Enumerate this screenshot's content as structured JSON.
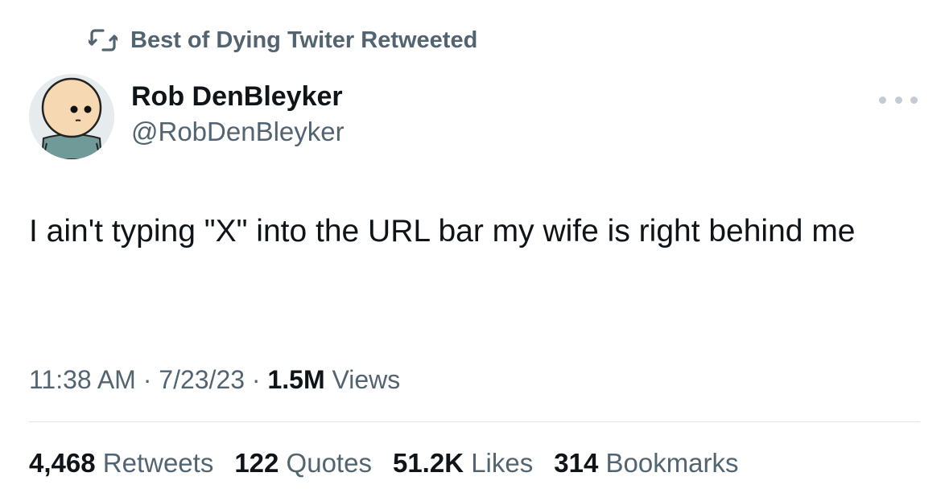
{
  "social_context": {
    "icon": "retweet-icon",
    "text": "Best of Dying Twiter Retweeted"
  },
  "author": {
    "avatar": "cartoon-avatar",
    "name": "Rob DenBleyker",
    "handle": "@RobDenBleyker"
  },
  "more_icon": "more-dots-icon",
  "tweet": {
    "text": "I ain't typing \"X\" into the URL bar my wife is right behind me"
  },
  "meta": {
    "time": "11:38 AM",
    "sep1": " · ",
    "date": "7/23/23",
    "sep2": " · ",
    "views_count": "1.5M",
    "views_label": " Views"
  },
  "stats": [
    {
      "count": "4,468",
      "label": " Retweets"
    },
    {
      "count": "122",
      "label": " Quotes"
    },
    {
      "count": "51.2K",
      "label": " Likes"
    },
    {
      "count": "314",
      "label": " Bookmarks"
    }
  ],
  "colors": {
    "text_primary": "#0f1419",
    "text_secondary": "#536471",
    "divider": "#dfe4e8",
    "avatar_bg": "#e6ebee"
  }
}
